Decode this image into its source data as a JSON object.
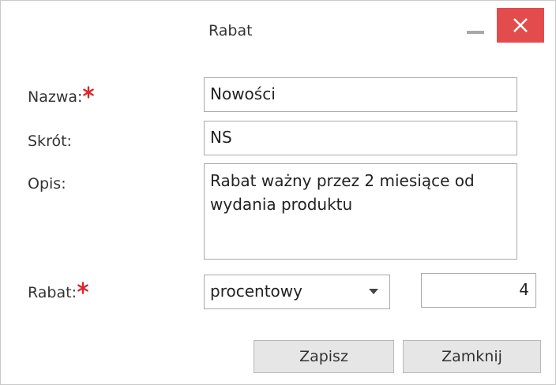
{
  "dialog": {
    "title": "Rabat"
  },
  "form": {
    "name": {
      "label": "Nazwa:",
      "value": "Nowości"
    },
    "short": {
      "label": "Skrót:",
      "value": "NS"
    },
    "desc": {
      "label": "Opis:",
      "value": "Rabat ważny przez 2 miesiące od wydania produktu"
    },
    "discount": {
      "label": "Rabat:",
      "type_value": "procentowy",
      "amount": "4"
    }
  },
  "buttons": {
    "save": "Zapisz",
    "close": "Zamknij"
  },
  "colors": {
    "required_marker": "#d8262b",
    "close_button": "#e34c4c"
  },
  "icons": {
    "required": "asterisk-icon",
    "window_close": "close-icon",
    "window_minimize": "minimize-icon",
    "dropdown": "chevron-down-icon"
  }
}
